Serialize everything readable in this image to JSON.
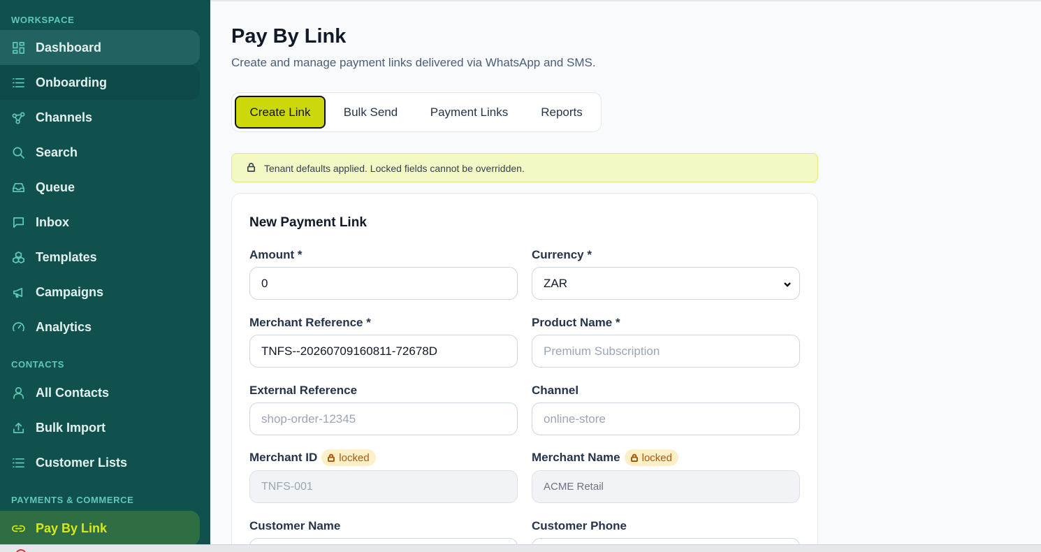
{
  "sidebar": {
    "sections": {
      "workspace": "WORKSPACE",
      "contacts": "CONTACTS",
      "payments": "PAYMENTS & COMMERCE"
    },
    "items": [
      {
        "label": "Dashboard",
        "icon": "grid-icon"
      },
      {
        "label": "Onboarding",
        "icon": "list-icon"
      },
      {
        "label": "Channels",
        "icon": "network-icon"
      },
      {
        "label": "Search",
        "icon": "search-icon"
      },
      {
        "label": "Queue",
        "icon": "inbox-tray-icon"
      },
      {
        "label": "Inbox",
        "icon": "message-square-icon"
      },
      {
        "label": "Templates",
        "icon": "cubes-icon"
      },
      {
        "label": "Campaigns",
        "icon": "megaphone-icon"
      },
      {
        "label": "Analytics",
        "icon": "gauge-icon"
      },
      {
        "label": "All Contacts",
        "icon": "user-icon"
      },
      {
        "label": "Bulk Import",
        "icon": "upload-icon"
      },
      {
        "label": "Customer Lists",
        "icon": "list-icon"
      },
      {
        "label": "Pay By Link",
        "icon": "link-icon"
      }
    ]
  },
  "header": {
    "title": "Pay By Link",
    "subtitle": "Create and manage payment links delivered via WhatsApp and SMS."
  },
  "tabs": [
    {
      "label": "Create Link",
      "active": true
    },
    {
      "label": "Bulk Send",
      "active": false
    },
    {
      "label": "Payment Links",
      "active": false
    },
    {
      "label": "Reports",
      "active": false
    }
  ],
  "notice": {
    "text": "Tenant defaults applied. Locked fields cannot be overridden."
  },
  "form": {
    "title": "New Payment Link",
    "locked_badge": "locked",
    "amount": {
      "label": "Amount *",
      "value": "0"
    },
    "currency": {
      "label": "Currency *",
      "value": "ZAR"
    },
    "merchant_reference": {
      "label": "Merchant Reference *",
      "value": "TNFS--20260709160811-72678D"
    },
    "product_name": {
      "label": "Product Name *",
      "placeholder": "Premium Subscription"
    },
    "external_reference": {
      "label": "External Reference",
      "placeholder": "shop-order-12345"
    },
    "channel": {
      "label": "Channel",
      "placeholder": "online-store"
    },
    "merchant_id": {
      "label": "Merchant ID",
      "placeholder": "TNFS-001"
    },
    "merchant_name": {
      "label": "Merchant Name",
      "value": "ACME Retail"
    },
    "customer_name": {
      "label": "Customer Name"
    },
    "customer_phone": {
      "label": "Customer Phone"
    }
  },
  "colors": {
    "sidebar_bg": "#10514e",
    "accent": "#ccd80a",
    "active_nav": "#2e6e42"
  }
}
